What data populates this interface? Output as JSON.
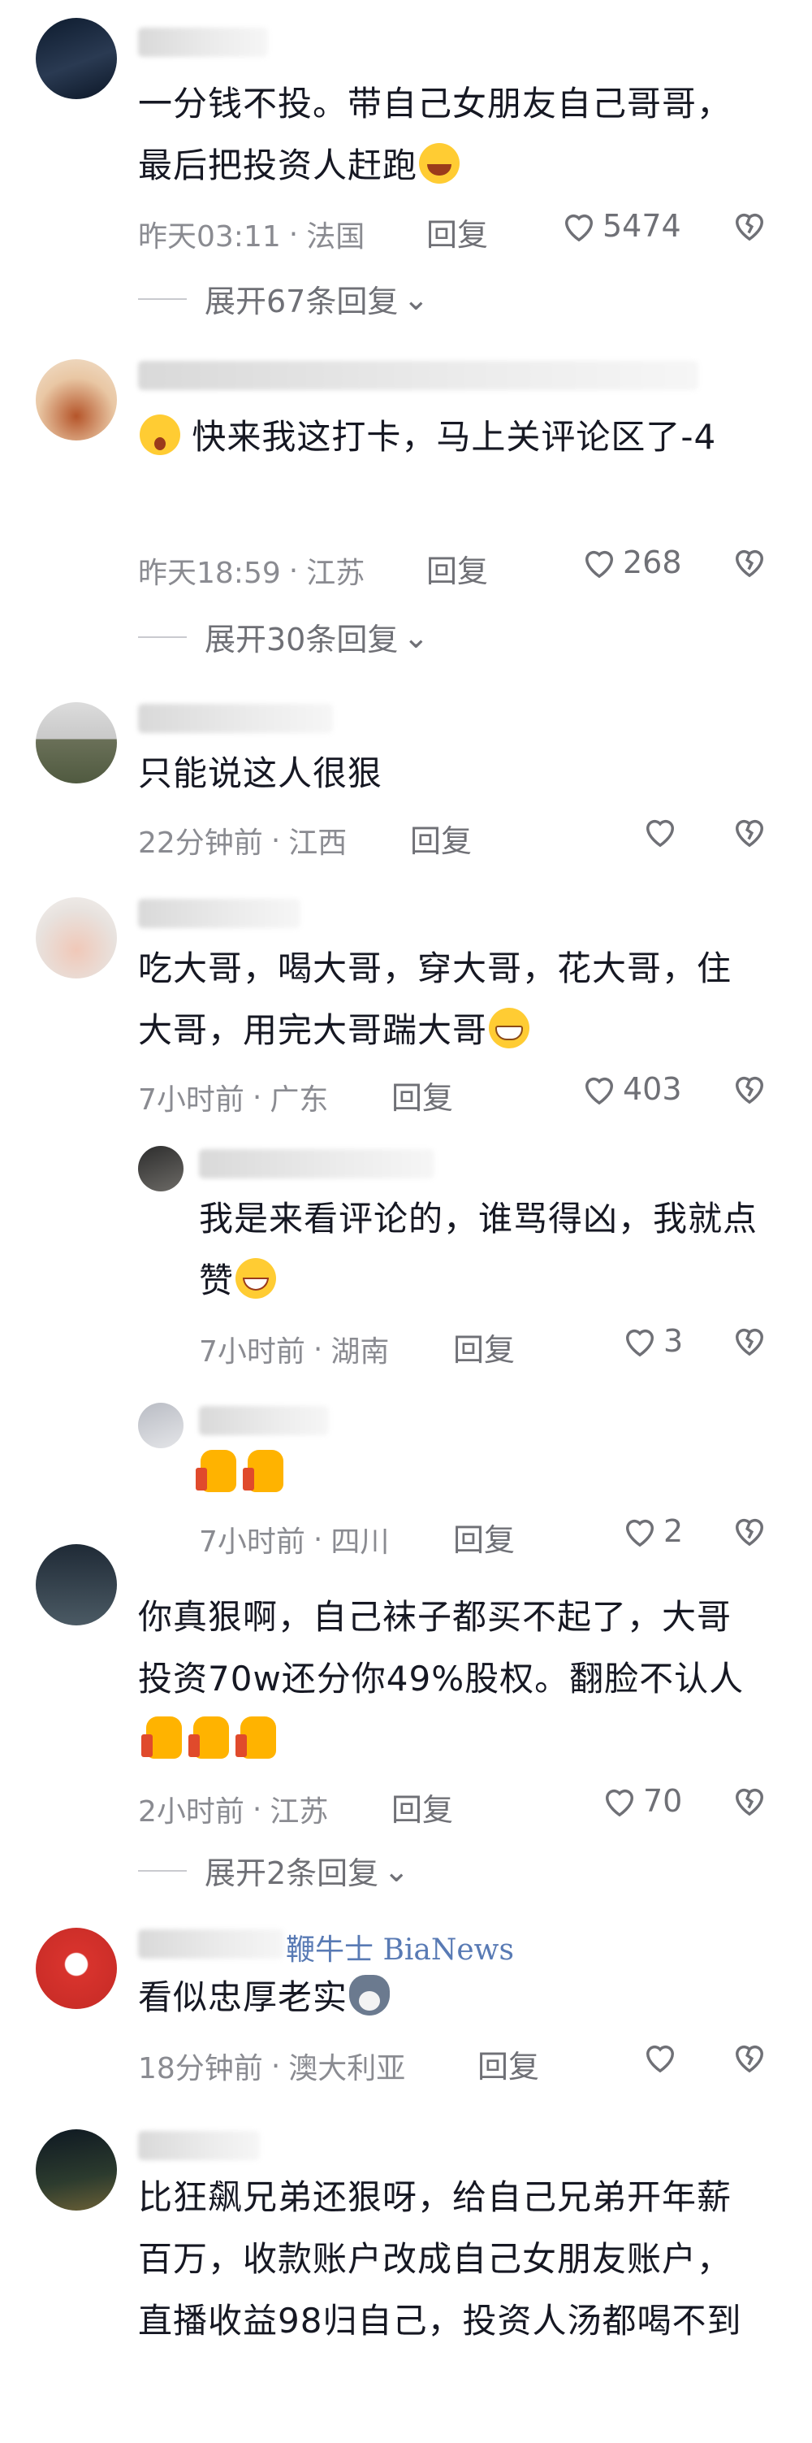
{
  "watermark": "鞭牛士 BiaNews",
  "comments": [
    {
      "text": "一分钱不投。带自己女朋友自己哥哥，最后把投资人赶跑",
      "emoji": "laugh-crying-emoji",
      "time": "昨天03:11",
      "location": "法国",
      "reply_label": "回复",
      "likes": "5474",
      "expand": "展开67条回复"
    },
    {
      "text": "快来我这打卡，马上关评论区了-4",
      "emoji_prefix": "shocked-emoji",
      "time": "昨天18:59",
      "location": "江苏",
      "reply_label": "回复",
      "likes": "268",
      "expand": "展开30条回复"
    },
    {
      "text": "只能说这人很狠",
      "time": "22分钟前",
      "location": "江西",
      "reply_label": "回复",
      "likes": ""
    },
    {
      "text": "吃大哥，喝大哥，穿大哥，花大哥，住大哥，用完大哥踹大哥",
      "emoji": "grinning-teeth-emoji",
      "time": "7小时前",
      "location": "广东",
      "reply_label": "回复",
      "likes": "403"
    },
    {
      "text": "我是来看评论的，谁骂得凶，我就点赞",
      "emoji": "grin-emoji",
      "time": "7小时前",
      "location": "湖南",
      "reply_label": "回复",
      "likes": "3"
    },
    {
      "text": "",
      "emoji": "thumbs-up-emoji",
      "time": "7小时前",
      "location": "四川",
      "reply_label": "回复",
      "likes": "2"
    },
    {
      "text": "你真狠啊，自己袜子都买不起了，大哥投资70w还分你49%股权。翻脸不认人",
      "emoji": "thumbs-up-emoji",
      "time": "2小时前",
      "location": "江苏",
      "reply_label": "回复",
      "likes": "70",
      "expand": "展开2条回复"
    },
    {
      "text": "看似忠厚老实",
      "emoji": "husky-emoji",
      "time": "18分钟前",
      "location": "澳大利亚",
      "reply_label": "回复",
      "likes": ""
    },
    {
      "text": "比狂飙兄弟还狠呀，给自己兄弟开年薪百万，收款账户改成自己女朋友账户，直播收益98归自己，投资人汤都喝不到"
    }
  ],
  "colors": {
    "text": "#161823",
    "meta": "#8a8b91",
    "action": "#6f7076",
    "watermark": "#3c63a8"
  }
}
